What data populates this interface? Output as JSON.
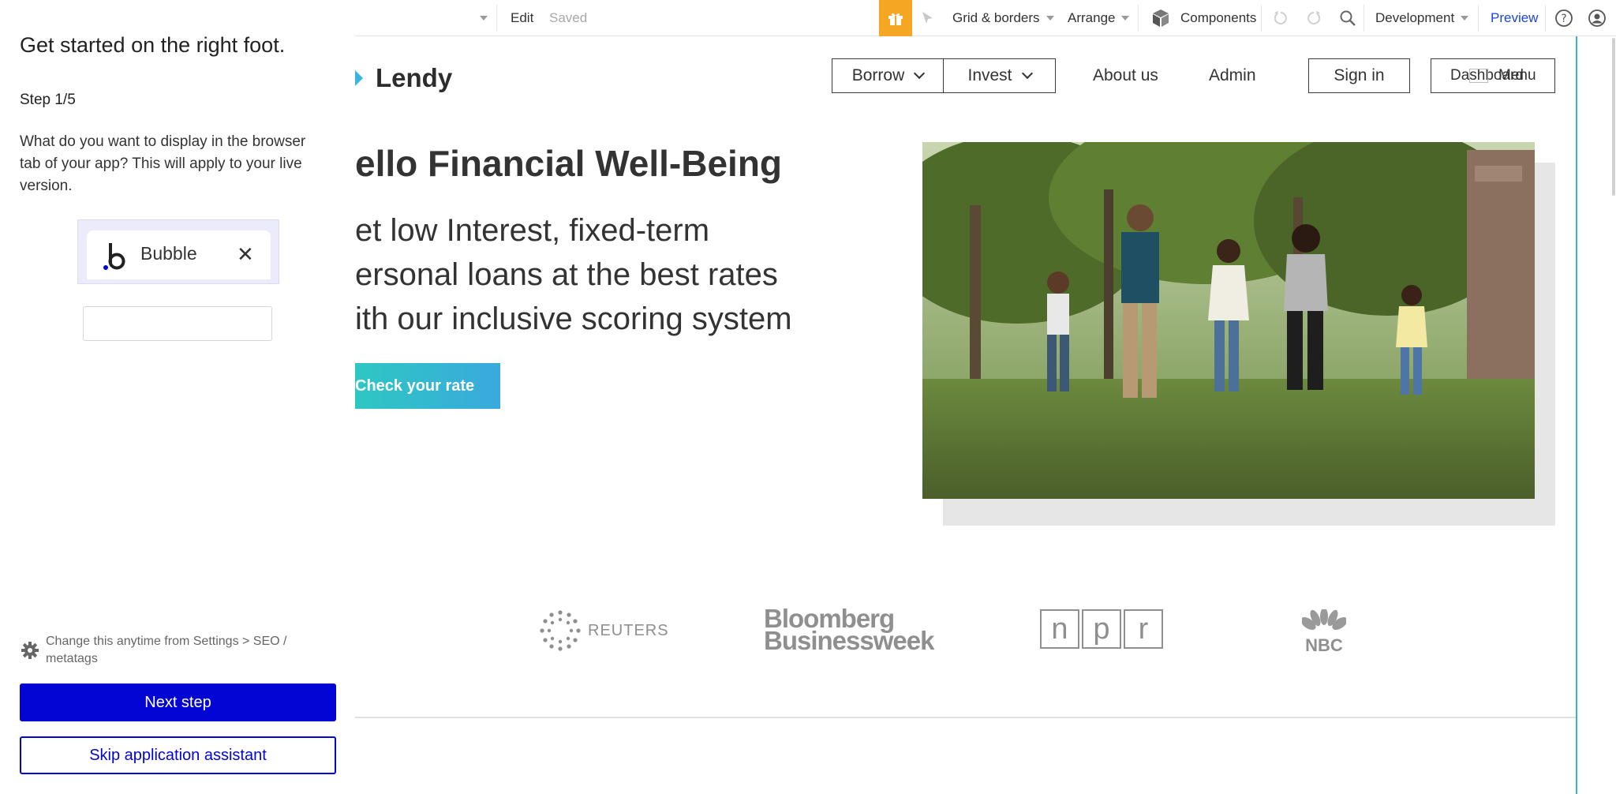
{
  "toolbar": {
    "edit": "Edit",
    "saved": "Saved",
    "grid_borders": "Grid & borders",
    "arrange": "Arrange",
    "components": "Components",
    "development": "Development",
    "preview": "Preview",
    "accent": "#f5a623",
    "preview_color": "#1a47d8"
  },
  "canvas": {
    "brand": "Lendy",
    "nav": {
      "borrow": "Borrow",
      "invest": "Invest",
      "about": "About us",
      "admin": "Admin",
      "signin": "Sign in",
      "dashboard": "Dashboard",
      "menu": "Menu"
    },
    "hero": {
      "title": "ello Financial Well-Being",
      "sub_line1": "et low Interest, fixed-term",
      "sub_line2": "ersonal loans at the best rates",
      "sub_line3": "ith our inclusive scoring system",
      "cta": "Check your rate"
    },
    "logos": {
      "reuters": "REUTERS",
      "bloomberg_line1": "Bloomberg",
      "bloomberg_line2": "Businessweek",
      "npr": [
        "n",
        "p",
        "r"
      ],
      "nbc": "NBC"
    }
  },
  "panel": {
    "title": "Get started on the right foot.",
    "step": "Step 1/5",
    "description": "What do you want to display in the browser tab of your app? This will apply to your live version.",
    "tab_name": "Bubble",
    "tab_close": "✕",
    "input_value": "",
    "note": "Change this anytime from Settings > SEO / metatags",
    "next_button": "Next step",
    "skip_button": "Skip application assistant",
    "primary_color": "#0205d3"
  }
}
